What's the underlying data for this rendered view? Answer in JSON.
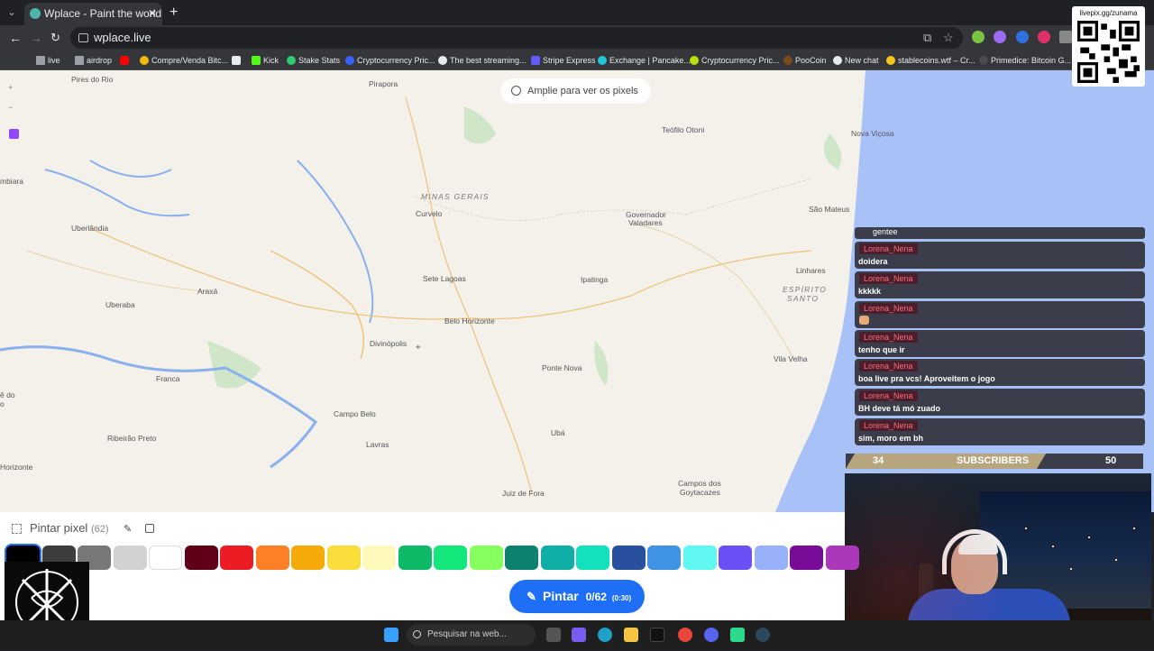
{
  "browser": {
    "tab_title": "Wplace - Paint the world",
    "url": "wplace.live",
    "bookmarks": [
      {
        "label": "live",
        "color": "#9aa0a6"
      },
      {
        "label": "airdrop",
        "color": "#9aa0a6"
      },
      {
        "label": "",
        "color": "#ff0000"
      },
      {
        "label": "Compre/Venda Bitc...",
        "color": "#f0b90b"
      },
      {
        "label": "",
        "color": "#e8eaed"
      },
      {
        "label": "Kick",
        "color": "#53fc18"
      },
      {
        "label": "Stake Stats",
        "color": "#2ecc71"
      },
      {
        "label": "Cryptocurrency Pric...",
        "color": "#3861fb"
      },
      {
        "label": "The best streaming...",
        "color": "#e8eaed"
      },
      {
        "label": "Stripe Express",
        "color": "#635bff"
      },
      {
        "label": "Exchange | Pancake...",
        "color": "#1fc7d4"
      },
      {
        "label": "Cryptocurrency Pric...",
        "color": "#b9e10b"
      },
      {
        "label": "PooCoin",
        "color": "#7a4b1e"
      },
      {
        "label": "New chat",
        "color": "#e8eaed"
      },
      {
        "label": "stablecoins.wtf – Cr...",
        "color": "#f5c518"
      },
      {
        "label": "Primedice: Bitcoin G...",
        "color": "#4a4a4e"
      }
    ]
  },
  "map": {
    "zoom_hint": "Amplie para ver os pixels",
    "regions": [
      "MINAS GERAIS",
      "ESPÍRITO",
      "SANTO"
    ],
    "cities": [
      "Pires do Rio",
      "Pirapora",
      "Teófilo Otoni",
      "Nova Viçosa",
      "mbiara",
      "Curvelo",
      "Governador",
      "Valadares",
      "São Mateus",
      "Uberlândia",
      "Sete Lagoas",
      "Ipatinga",
      "Linhares",
      "Araxá",
      "Uberaba",
      "Belo Horizonte",
      "Divinópolis",
      "Vila Velha",
      "Franca",
      "Ponte Nova",
      "Campo Belo",
      "Ribeirão Preto",
      "Ubá",
      "Lavras",
      "Horizonte",
      "Juiz de Fora",
      "Campos dos",
      "Goytacazes",
      "ê do",
      "o"
    ]
  },
  "overlay": {
    "qr_label": "livepix.gg/zunama"
  },
  "chat": {
    "top_text": "gentee",
    "messages": [
      {
        "user": "Lorena_Nena",
        "text": "doidera"
      },
      {
        "user": "Lorena_Nena",
        "text": "kkkkk"
      },
      {
        "user": "Lorena_Nena",
        "text": ""
      },
      {
        "user": "Lorena_Nena",
        "text": "tenho que ir"
      },
      {
        "user": "Lorena_Nena",
        "text": "boa live pra vcs! Aproveitem o jogo"
      },
      {
        "user": "Lorena_Nena",
        "text": "BH deve tá mó zuado"
      },
      {
        "user": "Lorena_Nena",
        "text": "sim, moro em bh"
      }
    ],
    "subs_current": "34",
    "subs_label": "SUBSCRIBERS",
    "subs_goal": "50"
  },
  "panel": {
    "title": "Pintar pixel",
    "count": "(62)",
    "paint_label": "Pintar",
    "paint_count": "0/62",
    "paint_timer": "(0:30)",
    "colors": [
      "#000000",
      "#3c3c3c",
      "#787878",
      "#d2d2d2",
      "#ffffff",
      "#600018",
      "#ed1c24",
      "#ff7f27",
      "#f6aa09",
      "#f9dd3b",
      "#fffabc",
      "#0eb968",
      "#13e67b",
      "#87ff5e",
      "#0c816e",
      "#10aea6",
      "#13e1be",
      "#28509e",
      "#4093e4",
      "#60f7f2",
      "#6b50f6",
      "#99b1fb",
      "#780c99",
      "#aa38b9"
    ]
  },
  "taskbar": {
    "search_placeholder": "Pesquisar na web..."
  }
}
